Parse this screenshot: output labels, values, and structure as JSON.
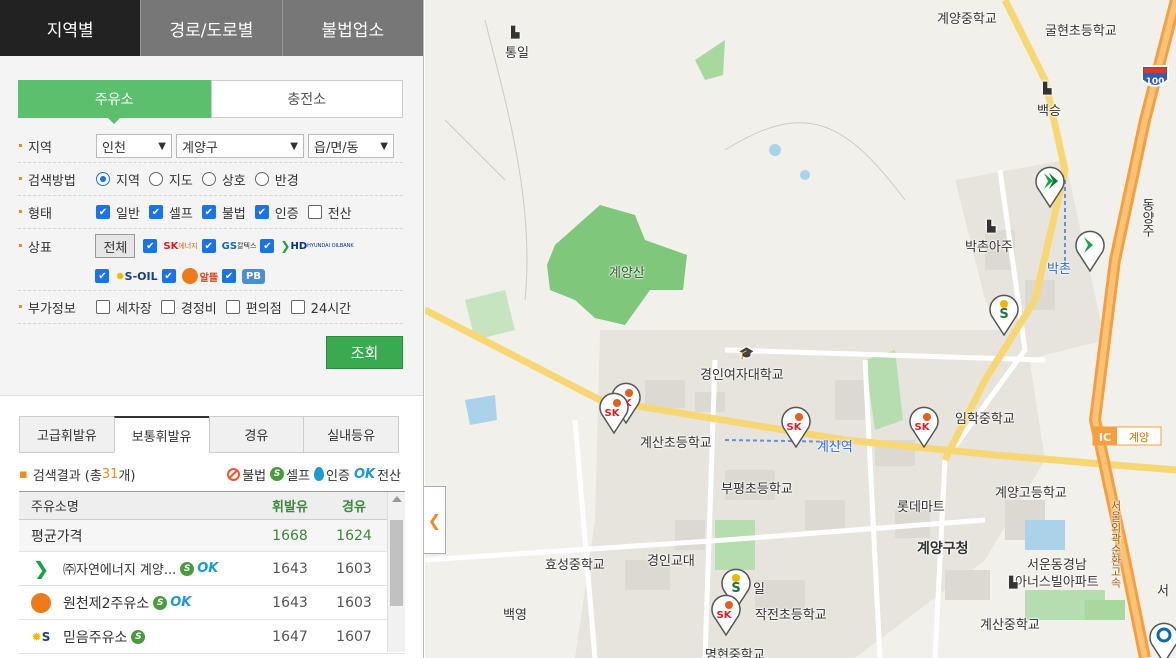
{
  "top_tabs": [
    "지역별",
    "경로/도로별",
    "불법업소"
  ],
  "sub_tabs": [
    "주유소",
    "충전소"
  ],
  "filter": {
    "region_label": "지역",
    "region_selects": [
      "인천",
      "계양구",
      "읍/면/동"
    ],
    "method_label": "검색방법",
    "methods": [
      "지역",
      "지도",
      "상호",
      "반경"
    ],
    "type_label": "형태",
    "types": [
      "일반",
      "셀프",
      "불법",
      "인증",
      "전산"
    ],
    "brand_label": "상표",
    "all_button": "전체",
    "brands": [
      "SK에너지",
      "GS칼텍스",
      "HD현대오일뱅크",
      "S-OIL",
      "알뜰",
      "PB"
    ],
    "extra_label": "부가정보",
    "extras": [
      "세차장",
      "경정비",
      "편의점",
      "24시간"
    ],
    "search_button": "조회"
  },
  "fuel_tabs": [
    "고급휘발유",
    "보통휘발유",
    "경유",
    "실내등유"
  ],
  "result": {
    "prefix": "검색결과 (총 ",
    "count": "31",
    "suffix": "개)",
    "legend": [
      "불법",
      "셀프",
      "인증",
      "전산"
    ]
  },
  "table": {
    "headers": [
      "주유소명",
      "휘발유",
      "경유"
    ],
    "avg": {
      "name": "평균가격",
      "gas": "1668",
      "diesel": "1624"
    },
    "rows": [
      {
        "name": "㈜자연에너지 계양...",
        "gas": "1643",
        "diesel": "1603",
        "brand": "HD현대오일뱅크"
      },
      {
        "name": "원천제2주유소",
        "gas": "1643",
        "diesel": "1603",
        "brand": "알뜰"
      },
      {
        "name": "믿음주유소",
        "gas": "1647",
        "diesel": "1607",
        "brand": "S-OIL"
      }
    ]
  },
  "map": {
    "labels": {
      "tongil": "통일",
      "gyeyang_middle": "계양중학교",
      "gulhyeon": "굴현초등학교",
      "baekseung": "백승",
      "dongyang": "동양주",
      "bakchon_apt": "박촌아주",
      "bakchon_stn": "박촌",
      "gyeyangsan": "계양산",
      "gyeongin_womens": "경인여자대학교",
      "imhak_middle": "임학중학교",
      "gyesan_elem": "계산초등학교",
      "gyesan_stn": "계산역",
      "ic": "IC",
      "gyeyang_ic": "계양",
      "bupyeong_elem": "부평초등학교",
      "lotte_mart": "롯데마트",
      "gyeyang_high": "계양고등학교",
      "hyoseong_middle": "효성중학교",
      "gyeongin_edu": "경인교대",
      "gyeyang_office": "계양구청",
      "seoun_apt_1": "서운동경남",
      "seoun_apt_2": "아너스빌아파트",
      "baekyeong": "백영",
      "jakjeon_elem": "작전초등학교",
      "gyesan_middle": "계산중학교",
      "myeongheon": "명현중학교",
      "highway_no": "100",
      "il": "일",
      "seo": "서",
      "express": "서울외곽순환고속"
    }
  },
  "colors": {
    "accent_green": "#5cbf6e",
    "search_green": "#3aaa50",
    "highway_orange": "#f5a040"
  }
}
